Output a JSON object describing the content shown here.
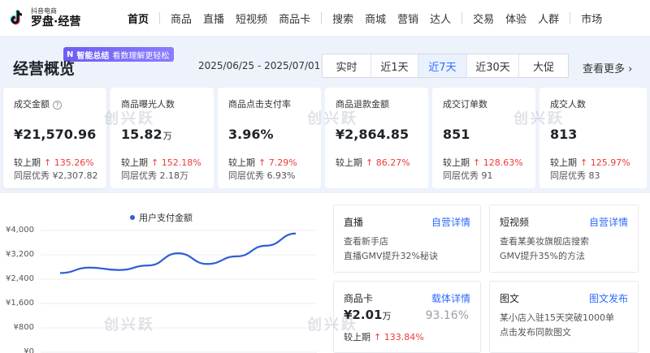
{
  "brand": {
    "small": "抖音电商",
    "name": "罗盘·经营"
  },
  "nav": [
    "首页",
    "商品",
    "直播",
    "短视频",
    "商品卡",
    "搜索",
    "商城",
    "营销",
    "达人",
    "交易",
    "体验",
    "人群",
    "市场"
  ],
  "header": {
    "title": "经营概览",
    "ai_badge": {
      "icon": "N",
      "strong": "智能总结",
      "text": "看数理解更轻松"
    },
    "date_range": "2025/06/25 - 2025/07/01",
    "tabs": [
      "实时",
      "近1天",
      "近7天",
      "近30天",
      "大促"
    ],
    "active_tab": "近7天",
    "view_more": "查看更多 ›"
  },
  "metrics": [
    {
      "label": "成交金额",
      "value": "¥21,570.96",
      "unit": "",
      "compare_label": "较上期",
      "compare": "↑ 135.26%",
      "peer": "同层优秀 ¥2,307.82"
    },
    {
      "label": "商品曝光人数",
      "value": "15.82",
      "unit": "万",
      "compare_label": "较上期",
      "compare": "↑ 152.18%",
      "peer": "同层优秀 2.18万"
    },
    {
      "label": "商品点击支付率",
      "value": "3.96%",
      "unit": "",
      "compare_label": "较上期",
      "compare": "↑ 7.29%",
      "peer": "同层优秀 6.93%"
    },
    {
      "label": "商品退款金额",
      "value": "¥2,864.85",
      "unit": "",
      "compare_label": "较上期",
      "compare": "↑ 86.27%",
      "peer": ""
    },
    {
      "label": "成交订单数",
      "value": "851",
      "unit": "",
      "compare_label": "较上期",
      "compare": "↑ 128.63%",
      "peer": "同层优秀 91"
    },
    {
      "label": "成交人数",
      "value": "813",
      "unit": "",
      "compare_label": "较上期",
      "compare": "↑ 125.97%",
      "peer": "同层优秀 83"
    }
  ],
  "chart_data": {
    "type": "line",
    "series": [
      {
        "name": "用户支付金额",
        "color": "#2f5ed6",
        "values": [
          2600,
          2780,
          2700,
          2850,
          3250,
          2900,
          3150,
          3500,
          3900
        ]
      }
    ],
    "yticks": [
      "¥4,000",
      "¥3,200",
      "¥2,400",
      "¥1,600",
      "¥800",
      "¥0"
    ],
    "ylim": [
      0,
      4000
    ]
  },
  "channels": {
    "live": {
      "title": "直播",
      "link": "自营详情",
      "line1": "查看新手店",
      "line2": "直播GMV提升32%秘诀"
    },
    "video": {
      "title": "短视频",
      "link": "自营详情",
      "line1": "查看某美妆旗舰店搜索",
      "line2": "GMV提升35%的方法"
    },
    "card": {
      "title": "商品卡",
      "link": "载体详情",
      "value": "¥2.01",
      "unit": "万",
      "pct": "93.16%",
      "compare_label": "较上期",
      "compare": "↑ 133.84%"
    },
    "image": {
      "title": "图文",
      "link": "图文发布",
      "line1": "某小店入驻15天突破1000单",
      "line2": "点击发布同款图文"
    }
  },
  "watermark": "创兴跃",
  "colors": {
    "accent": "#2f6bff",
    "up": "#ee3a3a",
    "line": "#2f5ed6"
  }
}
